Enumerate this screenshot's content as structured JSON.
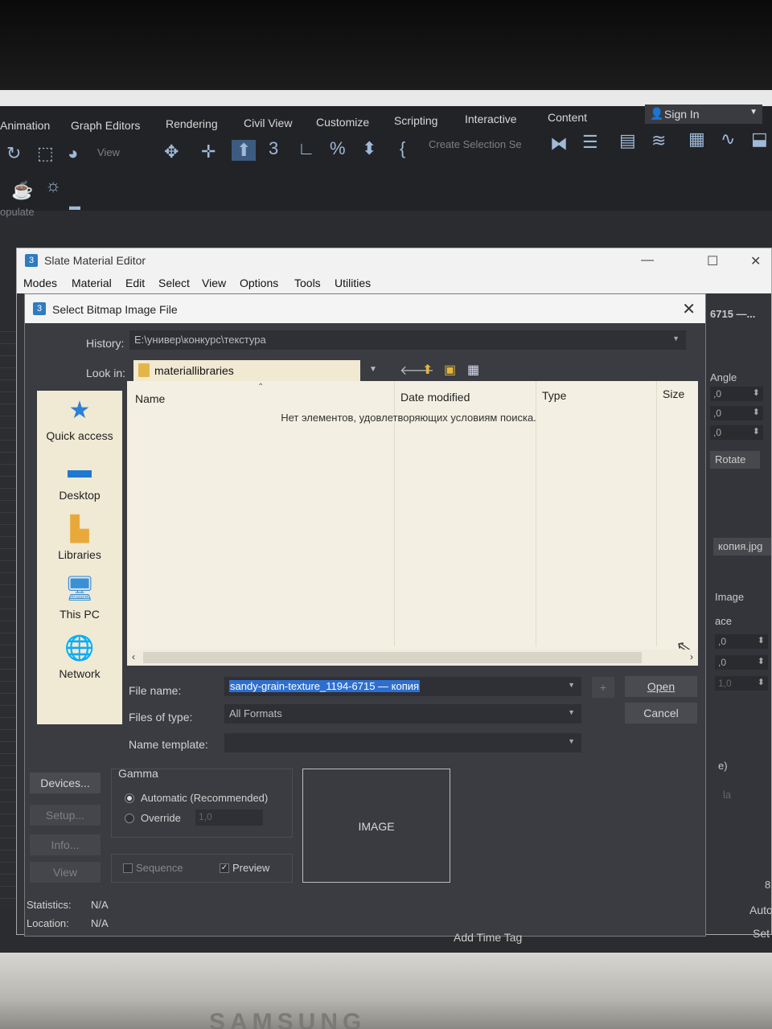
{
  "app": {
    "menu": [
      "Animation",
      "Graph Editors",
      "Rendering",
      "Civil View",
      "Customize",
      "Scripting",
      "Interactive",
      "Content"
    ],
    "sign_in": "Sign In",
    "toolbar_view": "View",
    "toolbar_selection": "Create Selection Se",
    "populate": "opulate",
    "add_time_tag": "Add Time Tag",
    "auto": "Auto",
    "set": "Set"
  },
  "slate": {
    "title": "Slate Material Editor",
    "menu": [
      "Modes",
      "Material",
      "Edit",
      "Select",
      "View",
      "Options",
      "Tools",
      "Utilities"
    ],
    "right_panel": {
      "tab_label": "6715 —...",
      "angle_label": "Angle",
      "spinners": [
        ",0",
        ",0",
        ",0"
      ],
      "rotate_button": "Rotate",
      "file_label": "копия.jpg",
      "image_button": "Image",
      "ace_label": "ace",
      "spinners2": [
        ",0",
        ",0",
        "1,0"
      ],
      "paren_label": "e)",
      "la_label": "la",
      "number_8": "8"
    }
  },
  "dialog": {
    "title": "Select Bitmap Image File",
    "history_label": "History:",
    "history_value": "E:\\универ\\конкурс\\текстура",
    "lookin_label": "Look in:",
    "lookin_value": "materiallibraries",
    "places": [
      {
        "label": "Quick access",
        "icon": "star-icon"
      },
      {
        "label": "Desktop",
        "icon": "desktop-icon"
      },
      {
        "label": "Libraries",
        "icon": "libraries-icon"
      },
      {
        "label": "This PC",
        "icon": "computer-icon"
      },
      {
        "label": "Network",
        "icon": "network-icon"
      }
    ],
    "columns": [
      "Name",
      "Date modified",
      "Type",
      "Size"
    ],
    "empty_message": "Нет элементов, удовлетворяющих условиям поиска.",
    "filename_label": "File name:",
    "filename_value": "sandy-grain-texture_1194-6715 — копия",
    "filetype_label": "Files of type:",
    "filetype_value": "All Formats",
    "nametemplate_label": "Name template:",
    "plus_button": "+",
    "open_button": "Open",
    "cancel_button": "Cancel",
    "devices_button": "Devices...",
    "setup_button": "Setup...",
    "info_button": "Info...",
    "view_button": "View",
    "gamma_label": "Gamma",
    "gamma_auto": "Automatic (Recommended)",
    "gamma_override": "Override",
    "gamma_override_value": "1,0",
    "sequence_label": "Sequence",
    "preview_label": "Preview",
    "preview_checked": true,
    "image_placeholder": "IMAGE",
    "statistics_label": "Statistics:",
    "statistics_value": "N/A",
    "location_label": "Location:",
    "location_value": "N/A"
  },
  "monitor_brand": "SAMSUNG"
}
